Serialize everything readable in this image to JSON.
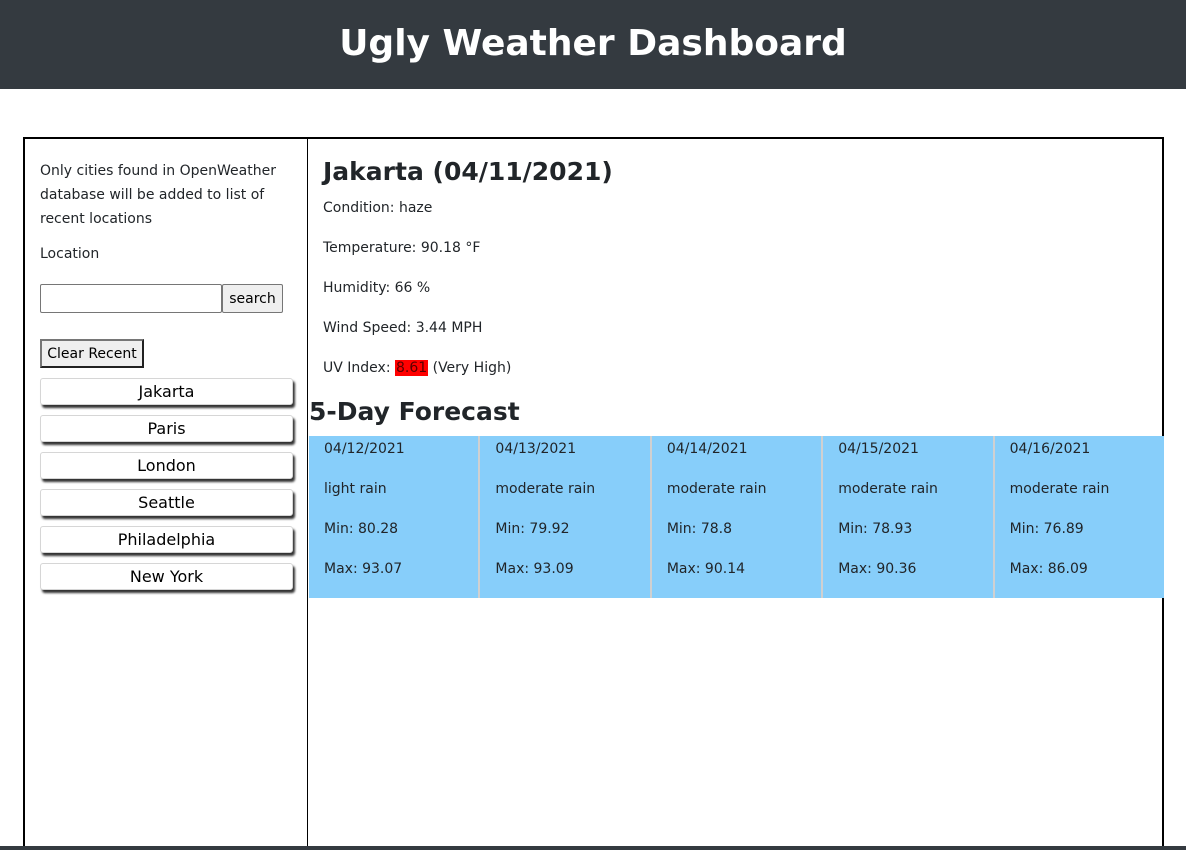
{
  "header": {
    "title": "Ugly Weather Dashboard"
  },
  "sidebar": {
    "note": "Only cities found in OpenWeather database will be added to list of recent locations",
    "location_label": "Location",
    "search_value": "",
    "search_button": "search",
    "clear_button": "Clear Recent",
    "recent": [
      "Jakarta",
      "Paris",
      "London",
      "Seattle",
      "Philadelphia",
      "New York"
    ]
  },
  "current": {
    "title": "Jakarta (04/11/2021)",
    "condition_label": "Condition: ",
    "condition": "haze",
    "temperature_label": "Temperature: ",
    "temperature": "90.18 °F",
    "humidity_label": "Humidity: ",
    "humidity": "66 %",
    "wind_label": "Wind Speed: ",
    "wind": "3.44 MPH",
    "uv_label": "UV Index: ",
    "uv_value": "8.61",
    "uv_desc": " (Very High)",
    "uv_color": "#ff0000"
  },
  "forecast": {
    "title": "5-Day Forecast",
    "days": [
      {
        "date": "04/12/2021",
        "desc": "light rain",
        "min": "Min: 80.28",
        "max": "Max: 93.07"
      },
      {
        "date": "04/13/2021",
        "desc": "moderate rain",
        "min": "Min: 79.92",
        "max": "Max: 93.09"
      },
      {
        "date": "04/14/2021",
        "desc": "moderate rain",
        "min": "Min: 78.8",
        "max": "Max: 90.14"
      },
      {
        "date": "04/15/2021",
        "desc": "moderate rain",
        "min": "Min: 78.93",
        "max": "Max: 90.36"
      },
      {
        "date": "04/16/2021",
        "desc": "moderate rain",
        "min": "Min: 76.89",
        "max": "Max: 86.09"
      }
    ],
    "card_color": "#87cefa"
  },
  "colors": {
    "header_bg": "#343a40",
    "header_text": "#ffffff"
  }
}
